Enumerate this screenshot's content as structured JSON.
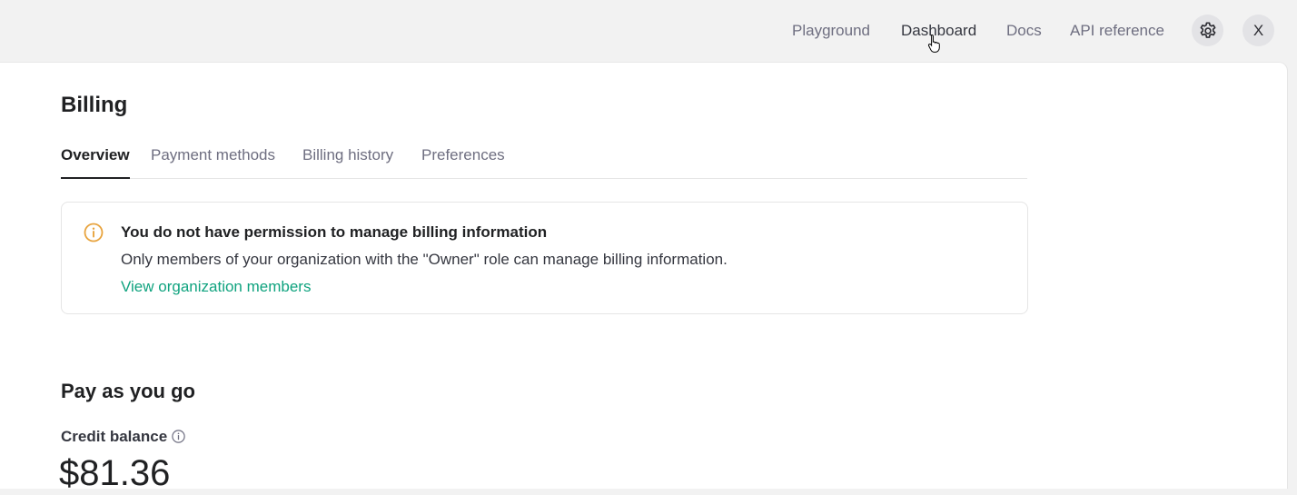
{
  "topnav": {
    "links": [
      "Playground",
      "Dashboard",
      "Docs",
      "API reference"
    ],
    "settings_icon": "gear-icon",
    "avatar_initial": "X"
  },
  "page": {
    "title": "Billing",
    "tabs": [
      "Overview",
      "Payment methods",
      "Billing history",
      "Preferences"
    ],
    "active_tab": "Overview"
  },
  "notice": {
    "icon": "info-icon",
    "title": "You do not have permission to manage billing information",
    "body": "Only members of your organization with the \"Owner\" role can manage billing information.",
    "link": "View organization members"
  },
  "payg": {
    "title": "Pay as you go",
    "credit_label": "Credit balance",
    "credit_amount": "$81.36"
  },
  "colors": {
    "accent": "#10a37f",
    "warning": "#e8a33d"
  }
}
